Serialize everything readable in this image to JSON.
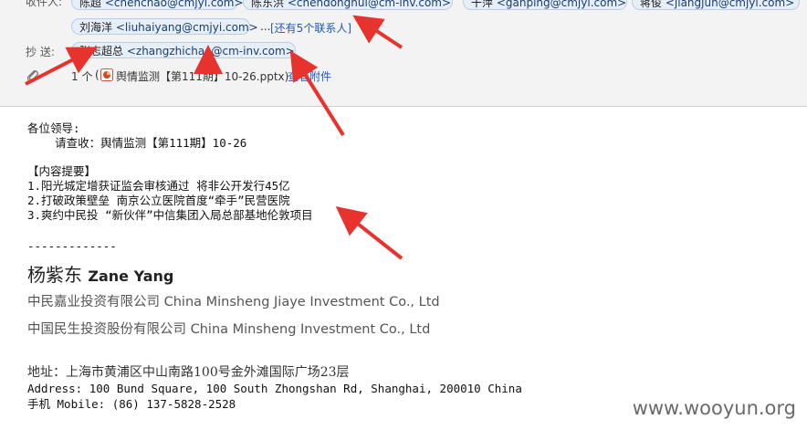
{
  "header": {
    "to_label": "收件人:",
    "to_chips": [
      {
        "name": "陈超",
        "email": "<chenchao@cmjyi.com>"
      },
      {
        "name": "陈东洪",
        "email": "<chendonghui@cm-inv.com>"
      },
      {
        "name": "干萍",
        "email": "<ganping@cmjyi.com>"
      },
      {
        "name": "蒋俊",
        "email": "<jiangjun@cmjyi.com>"
      }
    ],
    "to_row2_chip": {
      "name": "刘海洋",
      "email": "<liuhaiyang@cmjyi.com>"
    },
    "ellipsis": "...",
    "more_link": "[还有5个联系人]",
    "cc_label": "抄  送:",
    "cc_chip": {
      "name": "张志超总",
      "email": "<zhangzhichao@cm-inv.com>"
    },
    "attachment_count": "1 个",
    "attachment_paren_open": "(",
    "attachment_name": "舆情监测【第111期】10-26.pptx)",
    "view_attachment": "查看附件"
  },
  "body": {
    "greeting": "各位领导:",
    "line1": "    请查收：舆情监测【第111期】10-26",
    "summary_title": "【内容提要】",
    "items": [
      "1.阳光城定增获证监会审核通过 将非公开发行45亿",
      "2.打破政策壁垒 南京公立医院首度“牵手”民营医院",
      "3.爽约中民投 “新伙伴”中信集团入局总部基地伦敦项目"
    ],
    "divider": "-------------"
  },
  "signature": {
    "name_zh": "杨紫东",
    "name_en": "Zane Yang",
    "company1_zh": "中民嘉业投资有限公司",
    "company1_en": "China Minsheng Jiaye Investment Co., Ltd",
    "company2_zh": "中国民生投资股份有限公司",
    "company2_en": "China Minsheng Investment Co., Ltd",
    "address_zh": "地址：上海市黄浦区中山南路100号金外滩国际广场23层",
    "address_en": "Address: 100 Bund Square, 100 South Zhongshan Rd, Shanghai, 200010 China",
    "mobile": "手机 Mobile: (86) 137-5828-2528"
  },
  "watermark": "www.wooyun.org",
  "colors": {
    "arrow": "#e8322e",
    "chip_bg": "#e6eef8",
    "link": "#1c5bb8"
  }
}
